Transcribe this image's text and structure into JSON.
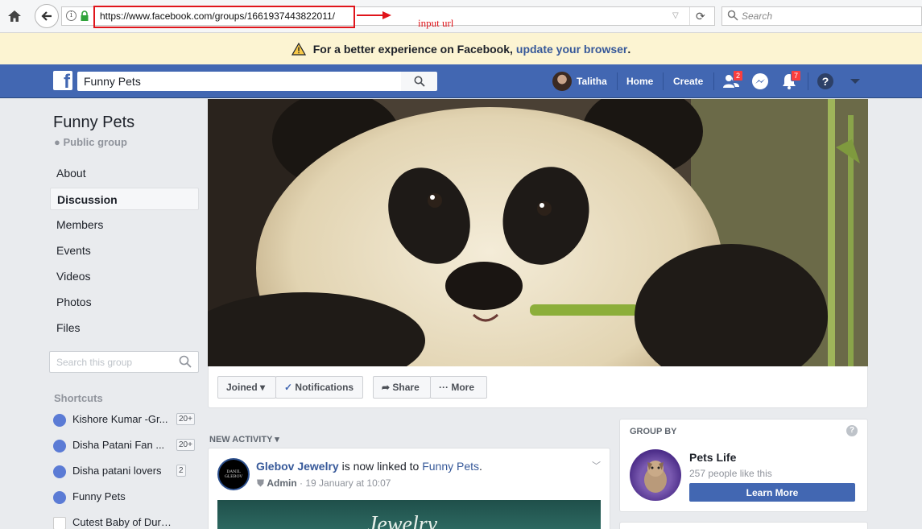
{
  "browser": {
    "url": "https://www.facebook.com/groups/1661937443822011/",
    "annotation_label": "input url",
    "search_placeholder": "Search"
  },
  "banner": {
    "text": "For a better experience on Facebook,",
    "link": "update your browser",
    "suffix": "."
  },
  "header": {
    "search_value": "Funny Pets",
    "user_name": "Talitha",
    "home_label": "Home",
    "create_label": "Create",
    "friend_requests_badge": "2",
    "notifications_badge": "7"
  },
  "group": {
    "name": "Funny Pets",
    "type": "Public group",
    "nav": [
      "About",
      "Discussion",
      "Members",
      "Events",
      "Videos",
      "Photos",
      "Files"
    ],
    "active_nav": "Discussion",
    "search_placeholder": "Search this group"
  },
  "shortcuts": {
    "title": "Shortcuts",
    "items": [
      {
        "label": "Kishore Kumar -Gr...",
        "count": "20+"
      },
      {
        "label": "Disha Patani Fan ...",
        "count": "20+"
      },
      {
        "label": "Disha patani lovers",
        "count": "2"
      },
      {
        "label": "Funny Pets",
        "count": ""
      },
      {
        "label": "Cutest Baby of Durg-Bh...",
        "count": ""
      }
    ]
  },
  "actions": {
    "joined": "Joined",
    "notifications": "Notifications",
    "share": "Share",
    "more": "More"
  },
  "feed": {
    "section_title": "NEW ACTIVITY",
    "post": {
      "author": "Glebov Jewelry",
      "middle": " is now linked to ",
      "target": "Funny Pets",
      "end": ".",
      "role": "Admin",
      "date": " · 19 January at 10:07",
      "avatar_text": "DANIL GLEBOV",
      "image_text": "Jewelry"
    }
  },
  "group_by": {
    "title": "GROUP BY",
    "page_name": "Pets Life",
    "likes": "257 people like this",
    "button": "Learn More"
  },
  "colors": {
    "facebook_blue": "#4267b2",
    "link_blue": "#365899",
    "annotation_red": "#e0151b",
    "banner_bg": "#fcf4d2",
    "badge_red": "#fa3e3e"
  }
}
